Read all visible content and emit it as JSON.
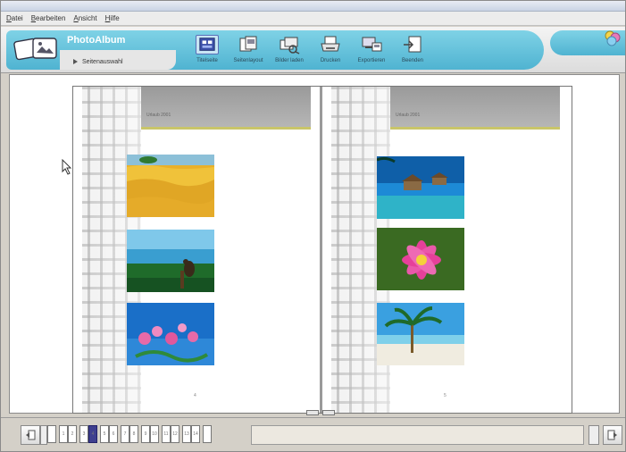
{
  "menu": {
    "items": [
      "Datei",
      "Bearbeiten",
      "Ansicht",
      "Hilfe"
    ]
  },
  "app": {
    "title": "PhotoAlbum",
    "sub_link": "Seitenauswahl"
  },
  "toolbar": {
    "tools": [
      {
        "name": "Titelseite",
        "icon": "album-cover-icon",
        "active": true
      },
      {
        "name": "Seitenlayout",
        "icon": "page-layout-icon"
      },
      {
        "name": "Bilder laden",
        "icon": "load-pictures-icon"
      },
      {
        "name": "Drucken",
        "icon": "print-icon"
      },
      {
        "name": "Exportieren",
        "icon": "export-icon"
      },
      {
        "name": "Beenden",
        "icon": "exit-icon"
      }
    ]
  },
  "album": {
    "left_page": {
      "header_text": "Urlaub 2001",
      "page_number": "4",
      "photos": [
        "wheat-field-photo",
        "bird-on-fence-photo",
        "pink-flowers-photo"
      ]
    },
    "right_page": {
      "header_text": "Urlaub 2001",
      "page_number": "5",
      "photos": [
        "water-bungalows-photo",
        "pink-lotus-photo",
        "palm-beach-photo"
      ]
    }
  },
  "navigation": {
    "pages": [
      "",
      "1",
      "2",
      "3",
      "4",
      "5",
      "6",
      "7",
      "8",
      "9",
      "10",
      "11",
      "12",
      "13",
      "14",
      ""
    ],
    "current_index": 4
  },
  "colors": {
    "header_accent": "#4fb3d1",
    "current_page": "#3f3f8f",
    "page_header_stripe": "#c9c56a"
  }
}
